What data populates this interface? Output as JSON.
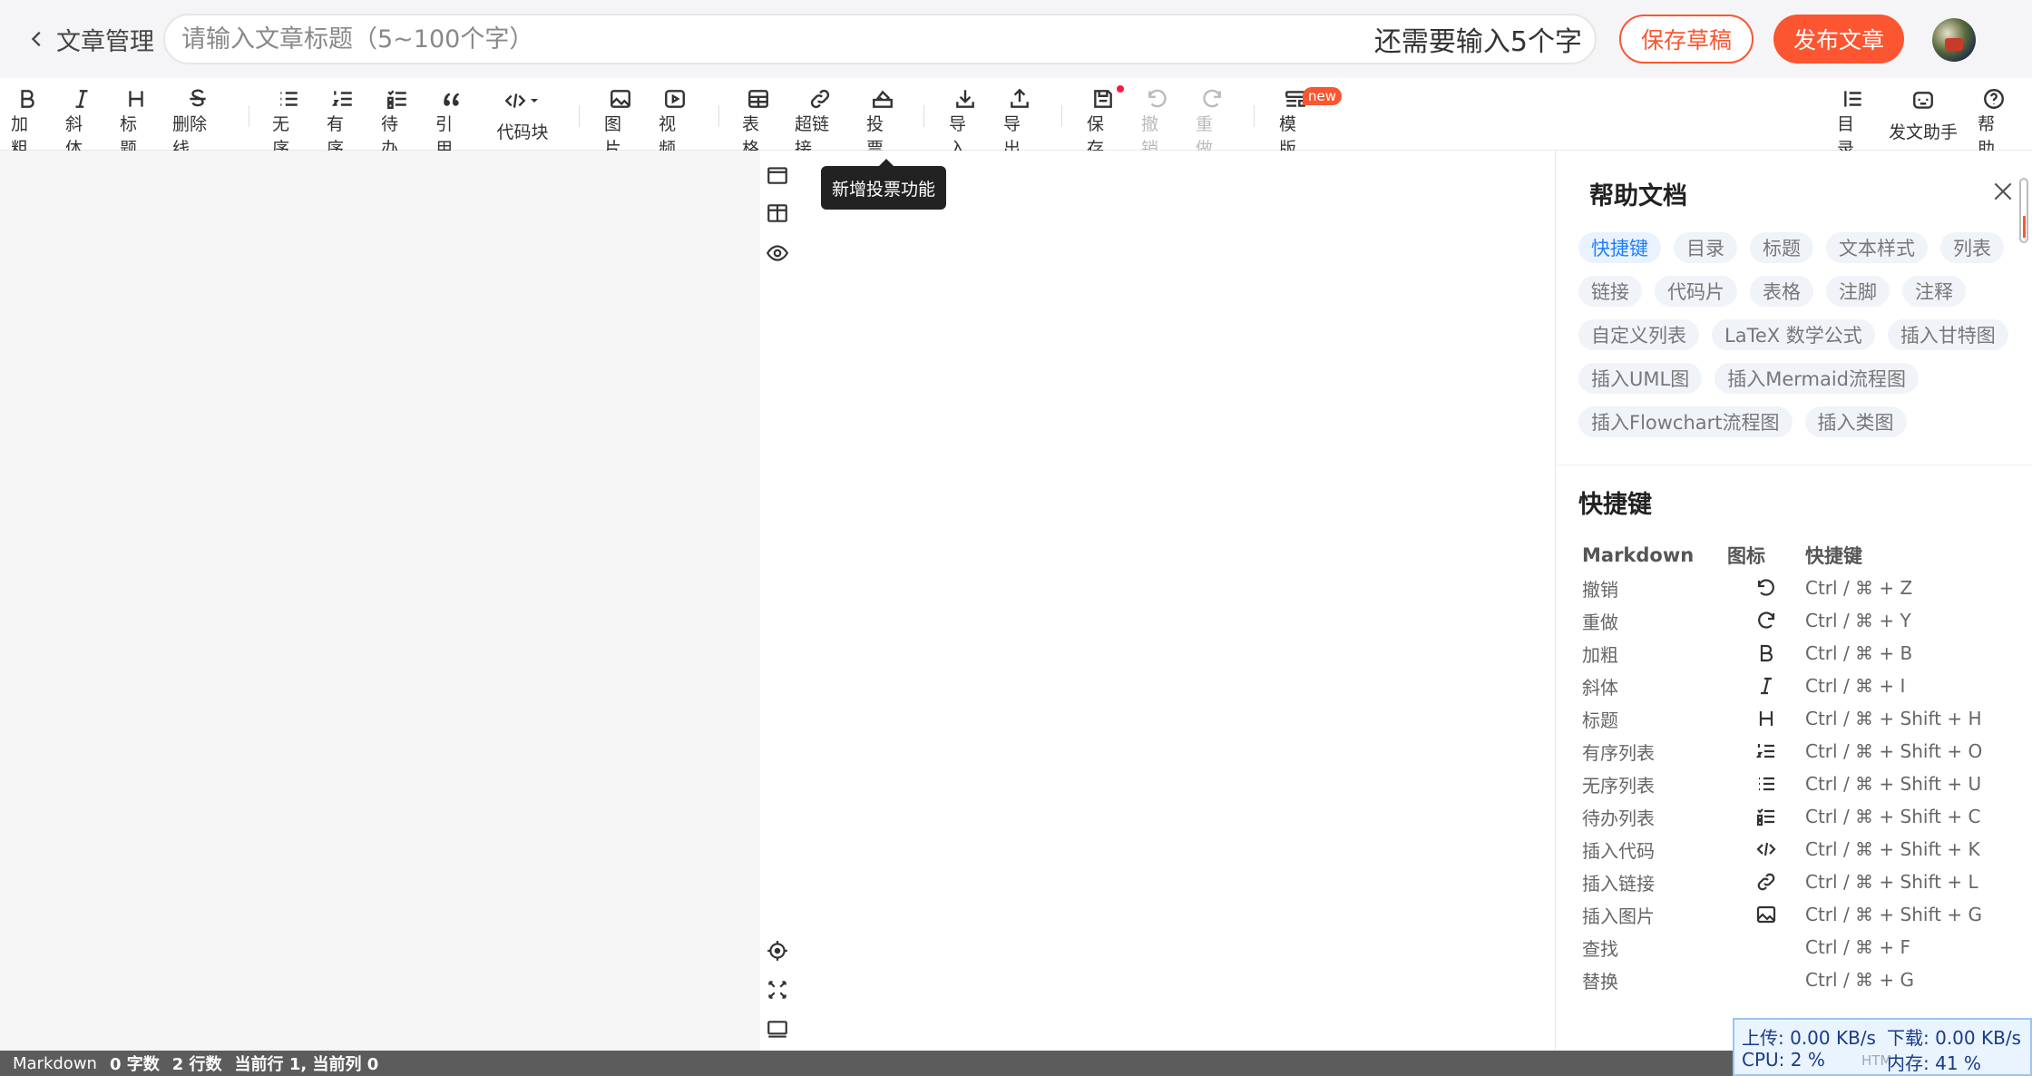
{
  "topbar": {
    "back_label": "文章管理",
    "title_placeholder": "请输入文章标题（5~100个字）",
    "title_value": "",
    "char_hint": "还需要输入5个字",
    "save_draft": "保存草稿",
    "publish": "发布文章"
  },
  "toolbar": {
    "bold": "加粗",
    "italic": "斜体",
    "heading": "标题",
    "strike": "删除线",
    "ul": "无序",
    "ol": "有序",
    "todo": "待办",
    "quote": "引用",
    "code": "代码块",
    "image": "图片",
    "video": "视频",
    "table": "表格",
    "link": "超链接",
    "vote": "投票",
    "import": "导入",
    "export": "导出",
    "save": "保存",
    "undo": "撤销",
    "redo": "重做",
    "template": "模版",
    "template_badge": "new",
    "toc": "目录",
    "assistant": "发文助手",
    "help": "帮助"
  },
  "tooltip": "新增投票功能",
  "help_panel": {
    "title": "帮助文档",
    "tags": [
      "快捷键",
      "目录",
      "标题",
      "文本样式",
      "列表",
      "链接",
      "代码片",
      "表格",
      "注脚",
      "注释",
      "自定义列表",
      "LaTeX 数学公式",
      "插入甘特图",
      "插入UML图",
      "插入Mermaid流程图",
      "插入Flowchart流程图",
      "插入类图"
    ],
    "active_tag": "快捷键",
    "shortcut_title": "快捷键",
    "table_headers": [
      "Markdown",
      "图标",
      "快捷键"
    ],
    "rows": [
      {
        "name": "撤销",
        "icon": "undo-icon",
        "keys": "Ctrl / ⌘ + Z"
      },
      {
        "name": "重做",
        "icon": "redo-icon",
        "keys": "Ctrl / ⌘ + Y"
      },
      {
        "name": "加粗",
        "icon": "bold-icon",
        "keys": "Ctrl / ⌘ + B"
      },
      {
        "name": "斜体",
        "icon": "italic-icon",
        "keys": "Ctrl / ⌘ + I"
      },
      {
        "name": "标题",
        "icon": "heading-icon",
        "keys": "Ctrl / ⌘ + Shift + H"
      },
      {
        "name": "有序列表",
        "icon": "ordered-list-icon",
        "keys": "Ctrl / ⌘ + Shift + O"
      },
      {
        "name": "无序列表",
        "icon": "unordered-list-icon",
        "keys": "Ctrl / ⌘ + Shift + U"
      },
      {
        "name": "待办列表",
        "icon": "todo-list-icon",
        "keys": "Ctrl / ⌘ + Shift + C"
      },
      {
        "name": "插入代码",
        "icon": "code-icon",
        "keys": "Ctrl / ⌘ + Shift + K"
      },
      {
        "name": "插入链接",
        "icon": "link-icon",
        "keys": "Ctrl / ⌘ + Shift + L"
      },
      {
        "name": "插入图片",
        "icon": "image-icon",
        "keys": "Ctrl / ⌘ + Shift + G"
      },
      {
        "name": "查找",
        "icon": "",
        "keys": "Ctrl / ⌘ + F"
      },
      {
        "name": "替换",
        "icon": "",
        "keys": "Ctrl / ⌘ + G"
      }
    ]
  },
  "statusbar": {
    "mode": "Markdown",
    "words": "0 字数",
    "lines": "2 行数",
    "cursor": "当前行 1, 当前列 0"
  },
  "net_monitor": {
    "upload": "上传: 0.00 KB/s",
    "download": "下载: 0.00 KB/s",
    "cpu": "CPU: 2 %",
    "memory": "内存: 41 %",
    "partial": "HTM"
  },
  "colors": {
    "accent": "#fc5531",
    "link": "#1e80ff",
    "statusbar": "#5c5c5c"
  }
}
